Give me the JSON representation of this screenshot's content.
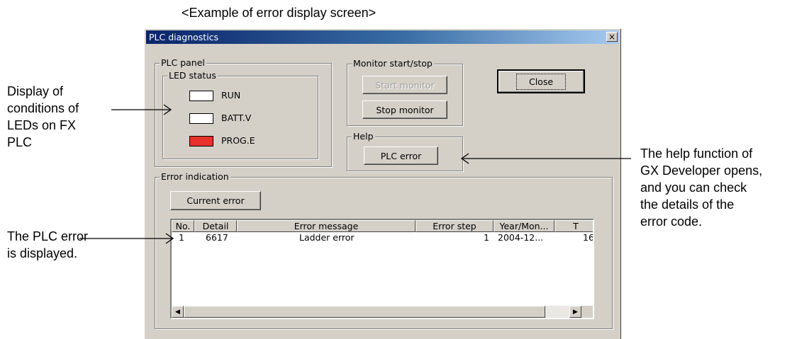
{
  "caption": "<Example of error display screen>",
  "annotations": {
    "led": [
      "Display of",
      "conditions of",
      "LEDs on FX",
      "PLC"
    ],
    "error": [
      "The PLC error",
      "is displayed."
    ],
    "help": [
      "The help function of",
      "GX Developer opens,",
      "and you can check",
      "the details of the",
      "error code."
    ]
  },
  "dialog": {
    "title": "PLC diagnostics",
    "close_x": "×",
    "plc_panel": {
      "label": "PLC panel",
      "led_status_label": "LED status",
      "leds": [
        {
          "label": "RUN",
          "color": "#ffffff"
        },
        {
          "label": "BATT.V",
          "color": "#ffffff"
        },
        {
          "label": "PROG.E",
          "color": "#e8302c"
        }
      ]
    },
    "monitor": {
      "label": "Monitor start/stop",
      "start": "Start monitor",
      "stop": "Stop monitor"
    },
    "help": {
      "label": "Help",
      "button": "PLC error"
    },
    "close_button": "Close",
    "error_indication": {
      "label": "Error indication",
      "current_error_button": "Current error",
      "columns": [
        "No.",
        "Detail",
        "Error message",
        "Error step",
        "Year/Mon...",
        "T"
      ],
      "rows": [
        {
          "no": "1",
          "detail": "6617",
          "message": "Ladder error",
          "step": "1",
          "date": "2004-12...",
          "time": "16:"
        }
      ]
    },
    "scroll_left": "◀",
    "scroll_right": "▶"
  }
}
